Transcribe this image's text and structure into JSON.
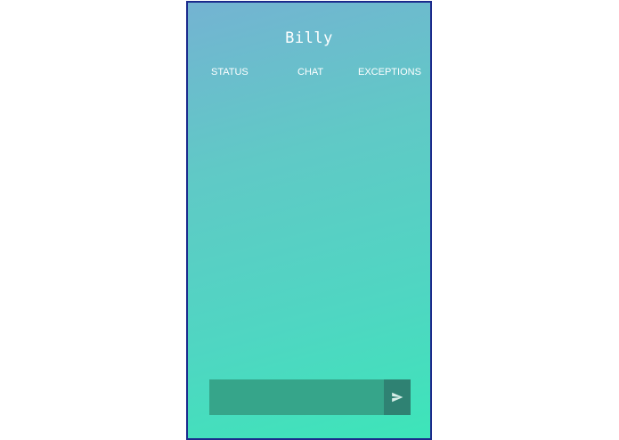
{
  "app": {
    "title": "Billy"
  },
  "tabs": [
    {
      "label": "STATUS"
    },
    {
      "label": "CHAT"
    },
    {
      "label": "EXCEPTIONS"
    }
  ],
  "composer": {
    "input_value": "",
    "send_icon": "send-icon"
  },
  "colors": {
    "frame_border": "#1b2a8c",
    "gradient_top": "#74b3d2",
    "gradient_bottom": "#3de5b9",
    "input_bg": "#36a58a",
    "send_bg": "#2f8273"
  }
}
